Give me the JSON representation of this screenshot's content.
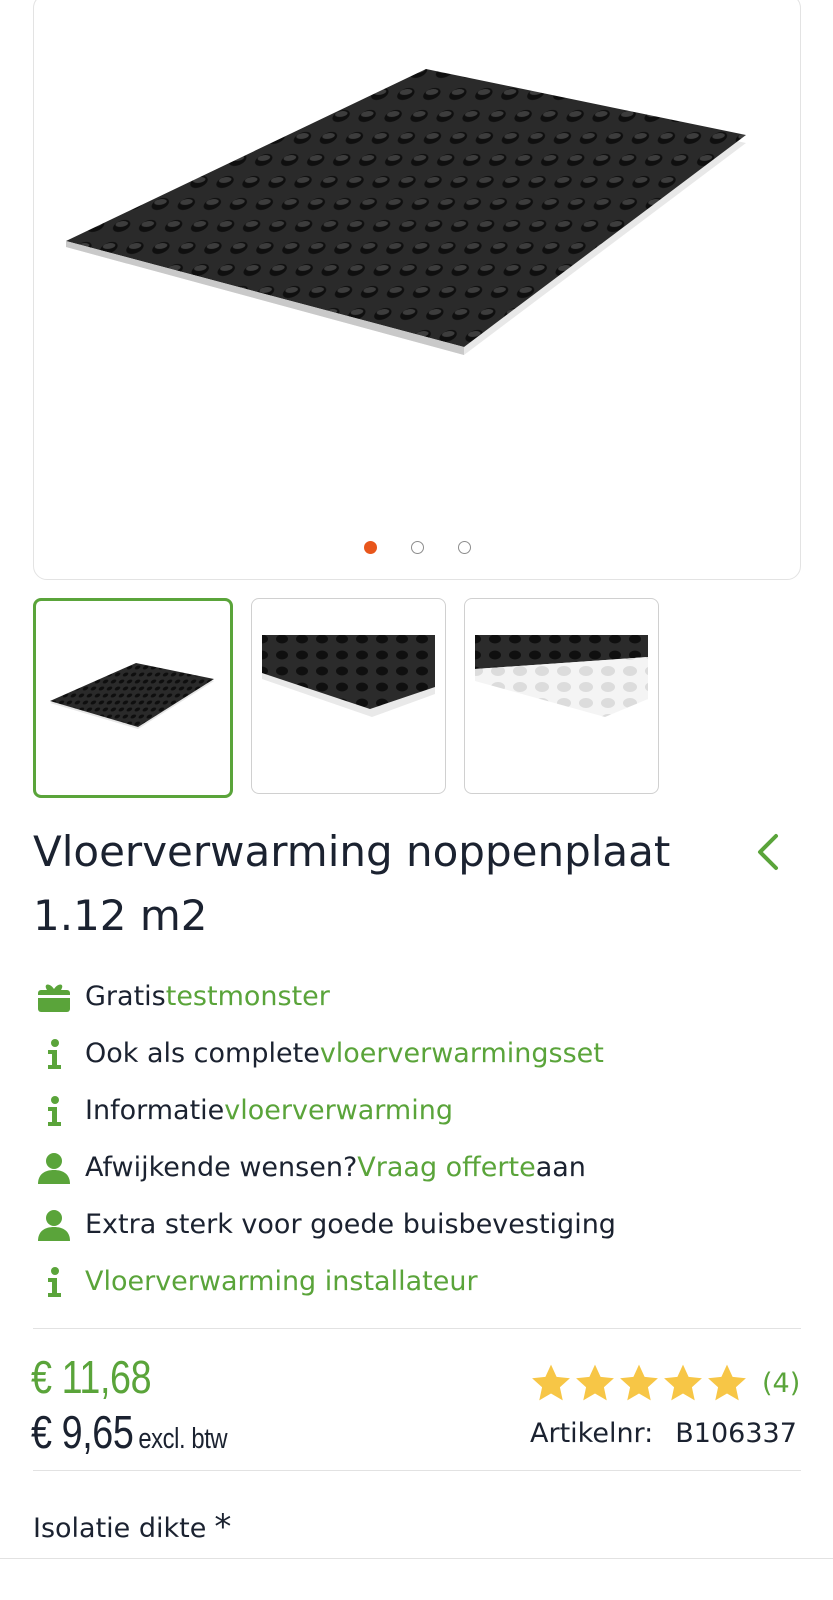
{
  "gallery": {
    "main_image_alt": "noppenplaat",
    "slide_count": 3,
    "active_slide": 1,
    "indicator_active_color": "#e8561c",
    "thumbnails": [
      {
        "name": "thumbnail-1",
        "active": true
      },
      {
        "name": "thumbnail-2",
        "active": false
      },
      {
        "name": "thumbnail-3",
        "active": false
      }
    ]
  },
  "product": {
    "title": "Vloerverwarming noppenplaat 1.12 m2"
  },
  "features": [
    {
      "icon": "gift-icon",
      "text": "Gratis ",
      "link": "testmonster",
      "after": ""
    },
    {
      "icon": "info-icon",
      "text": "Ook als complete ",
      "link": "vloerverwarmingsset",
      "after": ""
    },
    {
      "icon": "info-icon",
      "text": "Informatie ",
      "link": "vloerverwarming",
      "after": ""
    },
    {
      "icon": "user-icon",
      "text": "Afwijkende wensen? ",
      "link": "Vraag offerte",
      "after": " aan"
    },
    {
      "icon": "user-icon",
      "text": "Extra sterk voor goede buisbevestiging",
      "link": "",
      "after": ""
    },
    {
      "icon": "info-icon",
      "text": "",
      "link": "Vloerverwarming installateur",
      "after": ""
    }
  ],
  "pricing": {
    "price_incl": "€ 11,68",
    "price_excl": "€ 9,65",
    "excl_label": "excl. btw"
  },
  "rating": {
    "stars": 5,
    "count_label": "(4)",
    "star_color": "#f7c646"
  },
  "article": {
    "label": "Artikelnr:",
    "number": "B106337"
  },
  "options": {
    "first_label": "Isolatie dikte",
    "required_marker": "*"
  },
  "colors": {
    "accent_green": "#5aa43a",
    "text_dark": "#1b2230"
  }
}
